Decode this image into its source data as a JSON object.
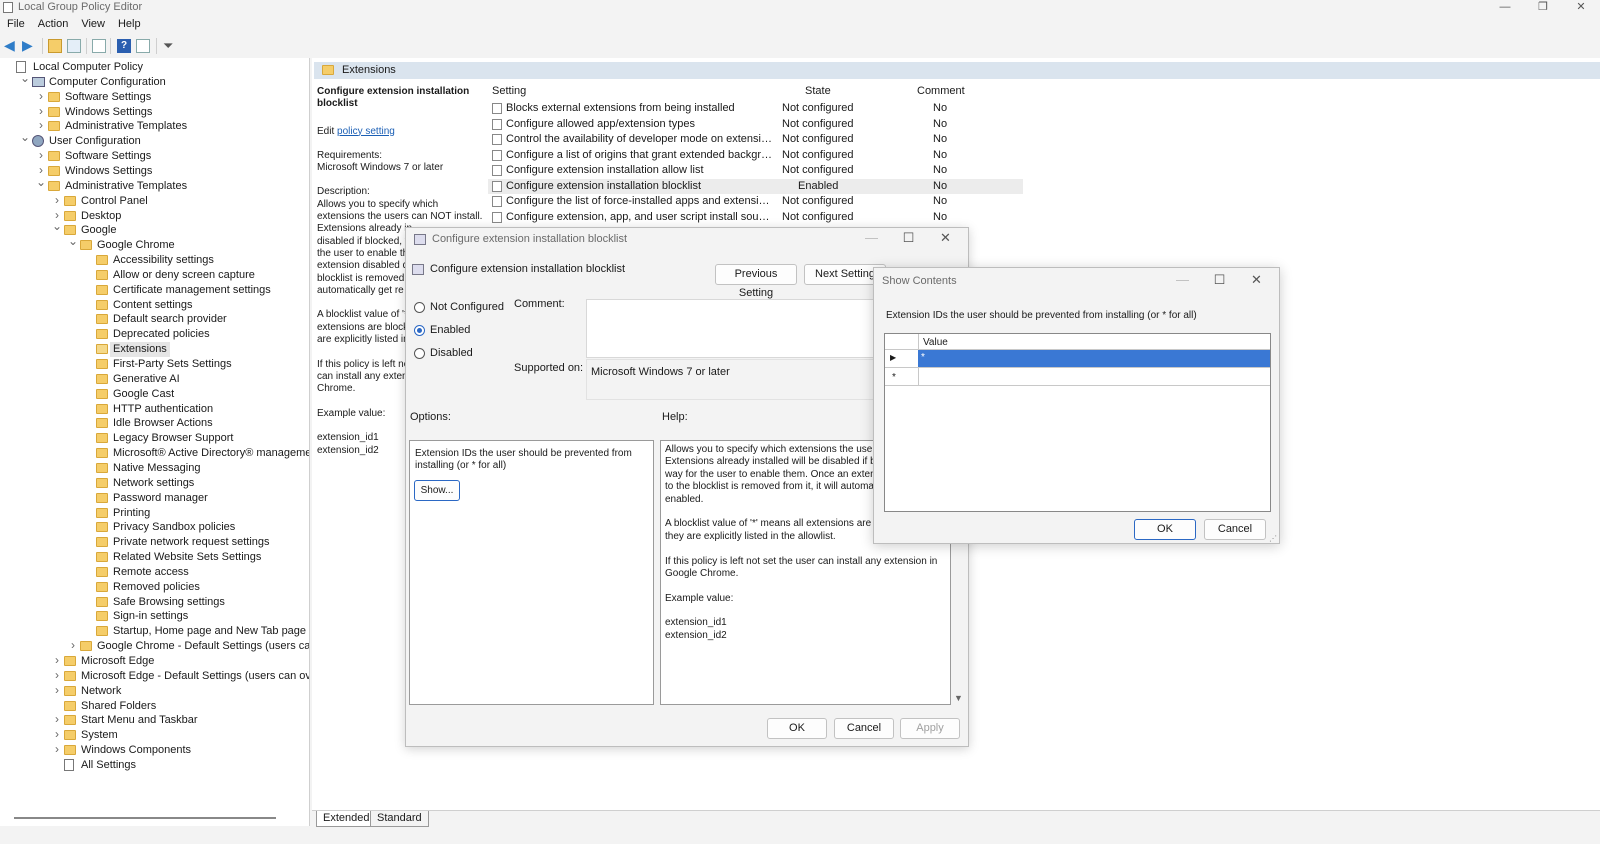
{
  "window": {
    "title": "Local Group Policy Editor",
    "controls": {
      "minimize": "—",
      "maximize": "❐",
      "close": "✕"
    }
  },
  "menu": [
    "File",
    "Action",
    "View",
    "Help"
  ],
  "toolbar": {
    "help_glyph": "?"
  },
  "tree": {
    "root": "Local Computer Policy",
    "computer_config": "Computer Configuration",
    "cc_software": "Software Settings",
    "cc_windows": "Windows Settings",
    "cc_admin": "Administrative Templates",
    "user_config": "User Configuration",
    "uc_software": "Software Settings",
    "uc_windows": "Windows Settings",
    "uc_admin": "Administrative Templates",
    "control_panel": "Control Panel",
    "desktop": "Desktop",
    "google": "Google",
    "google_chrome": "Google Chrome",
    "chrome_children": [
      "Accessibility settings",
      "Allow or deny screen capture",
      "Certificate management settings",
      "Content settings",
      "Default search provider",
      "Deprecated policies",
      "Extensions",
      "First-Party Sets Settings",
      "Generative AI",
      "Google Cast",
      "HTTP authentication",
      "Idle Browser Actions",
      "Legacy Browser Support",
      "Microsoft® Active Directory® management sett",
      "Native Messaging",
      "Network settings",
      "Password manager",
      "Printing",
      "Privacy Sandbox policies",
      "Private network request settings",
      "Related Website Sets Settings",
      "Remote access",
      "Removed policies",
      "Safe Browsing settings",
      "Sign-in settings",
      "Startup, Home page and New Tab page"
    ],
    "chrome_default": "Google Chrome - Default Settings (users can overrid",
    "ms_edge": "Microsoft Edge",
    "ms_edge_default": "Microsoft Edge - Default Settings (users can override)",
    "network": "Network",
    "shared_folders": "Shared Folders",
    "start_menu": "Start Menu and Taskbar",
    "system": "System",
    "win_components": "Windows Components",
    "all_settings": "All Settings"
  },
  "right": {
    "header": "Extensions",
    "desc": {
      "title": "Configure extension installation blocklist",
      "edit_prefix": "Edit ",
      "edit_link": "policy setting",
      "req_label": "Requirements:",
      "req_value": "Microsoft Windows 7 or later",
      "desc_label": "Description:",
      "lines": [
        "Allows you to specify which",
        "extensions the users can NOT install.",
        "Extensions already in",
        "disabled if blocked, w",
        "the user to enable th",
        "extension disabled d",
        "blocklist is removed",
        "automatically get re",
        "",
        "A blocklist value of '*",
        "extensions are block",
        "are explicitly listed in",
        "",
        "If this policy is left no",
        "can install any exten",
        "Chrome.",
        "",
        "Example value:",
        "",
        "extension_id1",
        "extension_id2"
      ]
    },
    "columns": {
      "setting": "Setting",
      "state": "State",
      "comment": "Comment"
    },
    "rows": [
      {
        "name": "Blocks external extensions from being installed",
        "state": "Not configured",
        "comment": "No"
      },
      {
        "name": "Configure allowed app/extension types",
        "state": "Not configured",
        "comment": "No"
      },
      {
        "name": "Control the availability of developer mode on extensions page",
        "state": "Not configured",
        "comment": "No"
      },
      {
        "name": "Configure a list of origins that grant extended background lifetime to connecting extensions",
        "state": "Not configured",
        "comment": "No"
      },
      {
        "name": "Configure extension installation allow list",
        "state": "Not configured",
        "comment": "No"
      },
      {
        "name": "Configure extension installation blocklist",
        "state": "Enabled",
        "comment": "No"
      },
      {
        "name": "Configure the list of force-installed apps and extensions",
        "state": "Not configured",
        "comment": "No"
      },
      {
        "name": "Configure extension, app, and user script install sources",
        "state": "Not configured",
        "comment": "No"
      }
    ],
    "tabs": [
      "Extended",
      "Standard"
    ]
  },
  "policy_dialog": {
    "title": "Configure extension installation blocklist",
    "heading": "Configure extension installation blocklist",
    "prev_button": "Previous Setting",
    "next_button": "Next Setting",
    "radio_not_configured": "Not Configured",
    "radio_enabled": "Enabled",
    "radio_disabled": "Disabled",
    "comment_label": "Comment:",
    "supported_label": "Supported on:",
    "supported_value": "Microsoft Windows 7 or later",
    "options_label": "Options:",
    "help_label": "Help:",
    "options_text": "Extension IDs the user should be prevented from installing (or * for all)",
    "show_button": "Show...",
    "help_lines": [
      "Allows you to specify which extensions the users",
      "Extensions already installed will be disabled if blo",
      "way for the user to enable them. Once an extensi",
      "to the blocklist is removed from it, it will automa",
      "enabled.",
      "",
      "A blocklist value of '*' means all extensions are b",
      "they are explicitly listed in the allowlist.",
      "",
      "If this policy is left not set the user can install any extension in",
      "Google Chrome.",
      "",
      "Example value:",
      "",
      "extension_id1",
      "extension_id2"
    ],
    "ok": "OK",
    "cancel": "Cancel",
    "apply": "Apply"
  },
  "show_dialog": {
    "title": "Show Contents",
    "prompt": "Extension IDs the user should be prevented from installing (or * for all)",
    "column": "Value",
    "rows": [
      {
        "marker": "▶",
        "value": "*"
      },
      {
        "marker": "*",
        "value": ""
      }
    ],
    "ok": "OK",
    "cancel": "Cancel"
  },
  "colors": {
    "selection": "#3a78d4",
    "accent_border": "#2b68c4",
    "header_band": "#dae4ee"
  }
}
